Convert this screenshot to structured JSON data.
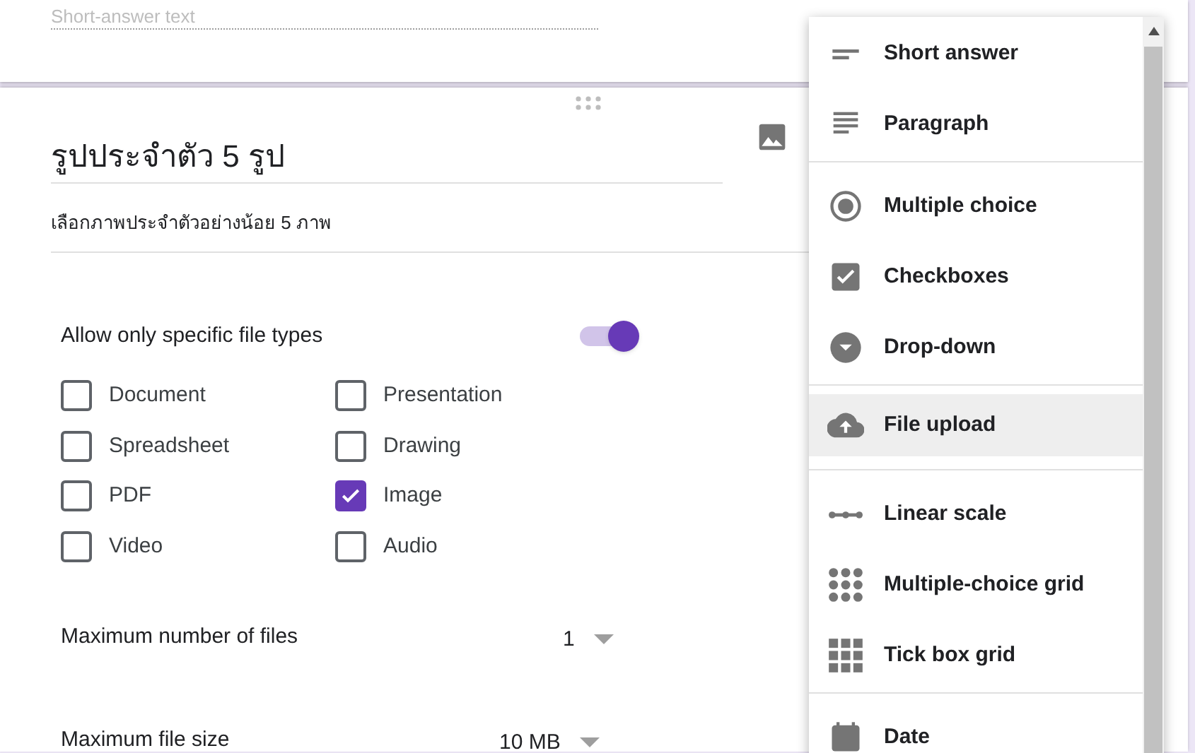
{
  "previous_question": {
    "placeholder": "Short-answer text"
  },
  "question": {
    "title": "รูปประจำตัว 5 รูป",
    "description": "เลือกภาพประจำตัวอย่างน้อย 5 ภาพ"
  },
  "file_types_toggle": {
    "label": "Allow only specific file types",
    "on": true
  },
  "file_types": [
    {
      "label": "Document",
      "checked": false
    },
    {
      "label": "Presentation",
      "checked": false
    },
    {
      "label": "Spreadsheet",
      "checked": false
    },
    {
      "label": "Drawing",
      "checked": false
    },
    {
      "label": "PDF",
      "checked": false
    },
    {
      "label": "Image",
      "checked": true
    },
    {
      "label": "Video",
      "checked": false
    },
    {
      "label": "Audio",
      "checked": false
    }
  ],
  "max_files": {
    "label": "Maximum number of files",
    "value": "1"
  },
  "max_size": {
    "label": "Maximum file size",
    "value": "10 MB"
  },
  "type_menu": {
    "groups": [
      [
        {
          "kind": "short",
          "label": "Short answer",
          "selected": false
        },
        {
          "kind": "paragraph",
          "label": "Paragraph",
          "selected": false
        }
      ],
      [
        {
          "kind": "radio",
          "label": "Multiple choice",
          "selected": false
        },
        {
          "kind": "checkbox",
          "label": "Checkboxes",
          "selected": false
        },
        {
          "kind": "dropdown",
          "label": "Drop-down",
          "selected": false
        }
      ],
      [
        {
          "kind": "upload",
          "label": "File upload",
          "selected": true
        }
      ],
      [
        {
          "kind": "scale",
          "label": "Linear scale",
          "selected": false
        },
        {
          "kind": "dotgrid",
          "label": "Multiple-choice grid",
          "selected": false
        },
        {
          "kind": "boxgrid",
          "label": "Tick box grid",
          "selected": false
        }
      ],
      [
        {
          "kind": "date",
          "label": "Date",
          "selected": false
        }
      ]
    ]
  }
}
